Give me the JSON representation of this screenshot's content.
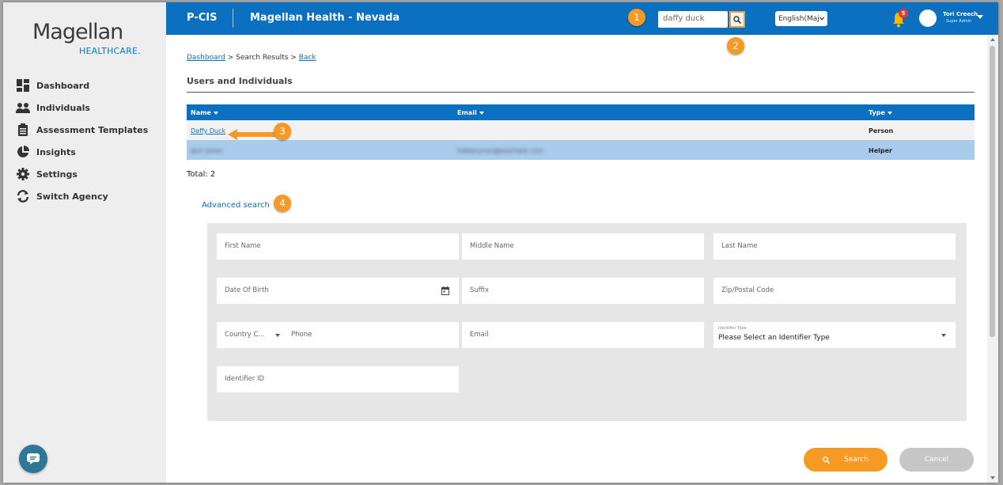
{
  "logo": {
    "main": "Magellan",
    "sub": "HEALTHCARE"
  },
  "sidebar": {
    "items": [
      {
        "label": "Dashboard",
        "icon": "dashboard-icon"
      },
      {
        "label": "Individuals",
        "icon": "people-icon"
      },
      {
        "label": "Assessment Templates",
        "icon": "clipboard-icon"
      },
      {
        "label": "Insights",
        "icon": "pie-chart-icon"
      },
      {
        "label": "Settings",
        "icon": "gear-icon"
      },
      {
        "label": "Switch Agency",
        "icon": "refresh-icon"
      }
    ]
  },
  "topbar": {
    "app_name": "P-CIS",
    "tenant": "Magellan Health - Nevada",
    "search_value": "daffy duck",
    "language": "English(Maj",
    "notification_count": "5",
    "user_name": "Tori Creech",
    "user_role": "Super Admin"
  },
  "breadcrumb": {
    "home": "Dashboard",
    "sep1": ">",
    "current": "Search Results",
    "sep2": ">",
    "back": "Back"
  },
  "section_title": "Users and Individuals",
  "table": {
    "headers": {
      "name": "Name",
      "email": "Email",
      "type": "Type"
    },
    "rows": [
      {
        "name": "Daffy Duck",
        "email": "",
        "type": "Person"
      },
      {
        "name": "Jack Jones",
        "email": "helperjones@example.com",
        "type": "Helper"
      }
    ]
  },
  "total": "Total: 2",
  "advanced_search": "Advanced search",
  "form": {
    "first_name": "First Name",
    "middle_name": "Middle Name",
    "last_name": "Last Name",
    "dob": "Date Of Birth",
    "suffix": "Suffix",
    "zip": "Zip/Postal Code",
    "country_code": "Country C...",
    "phone": "Phone",
    "email": "Email",
    "identifier_type_label": "Identifier Type",
    "identifier_type_value": "Please Select an Identifier Type",
    "identifier_id": "Identifier ID"
  },
  "buttons": {
    "search": "Search",
    "cancel": "Cancel"
  },
  "callouts": [
    "1",
    "2",
    "3",
    "4"
  ],
  "colors": {
    "brand_blue": "#0b70c0",
    "accent_orange": "#f79a23",
    "selected_row": "#a9ccec"
  }
}
